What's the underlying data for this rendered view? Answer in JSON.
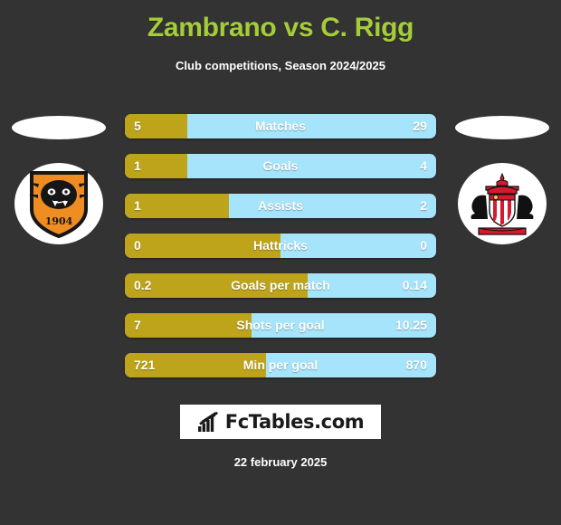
{
  "header": {
    "title": "Zambrano vs C. Rigg",
    "subtitle": "Club competitions, Season 2024/2025",
    "title_color": "#a5cd39"
  },
  "badges": {
    "home": {
      "name": "hull-city-crest",
      "year": "1904",
      "primary_color": "#ef8d22",
      "outline_color": "#1a1a1a"
    },
    "away": {
      "name": "sunderland-crest",
      "primary_color": "#d6192e",
      "outline_color": "#111111"
    }
  },
  "colors": {
    "home_bar": "#bda41a",
    "away_bar": "#a5e4fa",
    "background": "#333333",
    "text": "#ffffff"
  },
  "footer": {
    "logo_text": "FcTables.com",
    "logo_icon": "bar-chart-arrow-icon",
    "date": "22 february 2025"
  },
  "chart_data": {
    "type": "bar",
    "title": "Zambrano vs C. Rigg",
    "subtitle": "Club competitions, Season 2024/2025",
    "orientation": "horizontal-diverging",
    "legend": [
      "Zambrano",
      "C. Rigg"
    ],
    "categories": [
      "Matches",
      "Goals",
      "Assists",
      "Hattricks",
      "Goals per match",
      "Shots per goal",
      "Min per goal"
    ],
    "series": [
      {
        "name": "Zambrano",
        "color": "#bda41a",
        "values": [
          5,
          1,
          1,
          0,
          0.2,
          7,
          721
        ]
      },
      {
        "name": "C. Rigg",
        "color": "#a5e4fa",
        "values": [
          29,
          4,
          2,
          0,
          0.14,
          10.25,
          870
        ]
      }
    ],
    "rows": [
      {
        "label": "Matches",
        "left": "5",
        "right": "29",
        "left_pct": 20.0
      },
      {
        "label": "Goals",
        "left": "1",
        "right": "4",
        "left_pct": 20.0
      },
      {
        "label": "Assists",
        "left": "1",
        "right": "2",
        "left_pct": 33.3
      },
      {
        "label": "Hattricks",
        "left": "0",
        "right": "0",
        "left_pct": 50.0
      },
      {
        "label": "Goals per match",
        "left": "0.2",
        "right": "0.14",
        "left_pct": 58.8
      },
      {
        "label": "Shots per goal",
        "left": "7",
        "right": "10.25",
        "left_pct": 40.6
      },
      {
        "label": "Min per goal",
        "left": "721",
        "right": "870",
        "left_pct": 45.3
      }
    ]
  }
}
